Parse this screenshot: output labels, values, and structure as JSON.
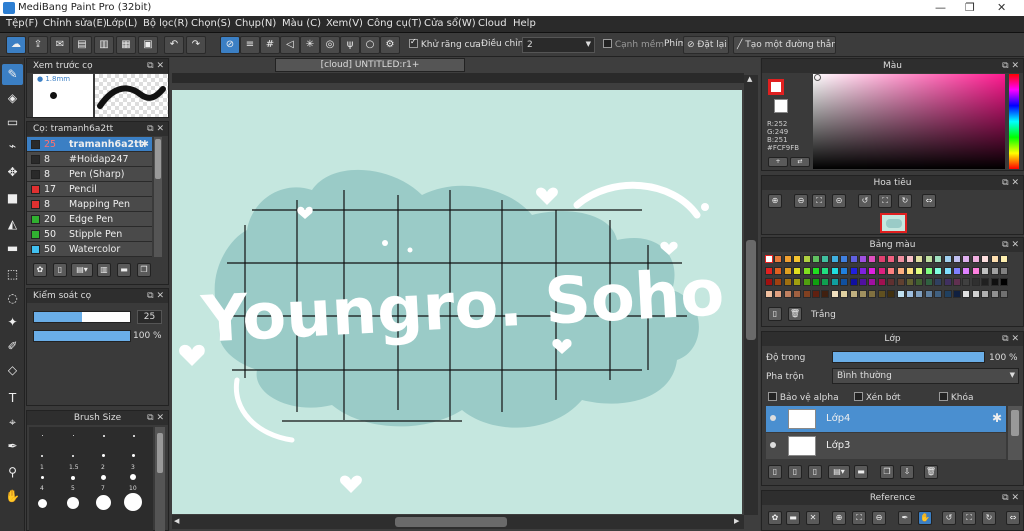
{
  "app": {
    "title": "MediBang Paint Pro (32bit)"
  },
  "menu": [
    "Tệp(F)",
    "Chỉnh sửa(E)",
    "Lớp(L)",
    "Bộ lọc(R)",
    "Chọn(S)",
    "Chụp(N)",
    "Màu (C)",
    "Xem(V)",
    "Công cụ(T)",
    "Cửa sổ(W)",
    "Cloud",
    "Help"
  ],
  "toolbar": {
    "antialias_label": "Khử răng cưa",
    "adjust_label": "Điều chỉnh",
    "adjust_value": "2",
    "sharp_edge_label": "Cạnh mềm",
    "key_label": "Phím",
    "reset_label": "Đặt lại",
    "make_line_label": "Tạo một đường thẳng"
  },
  "brush_preview": {
    "title": "Xem trước cọ",
    "size": "1.8mm"
  },
  "brush_panel": {
    "title": "Cọ: tramanh6a2tt",
    "items": [
      {
        "size": "25",
        "name": "tramanh6a2tt",
        "color": "#2a2a2a"
      },
      {
        "size": "8",
        "name": "#Hoidap247",
        "color": "#2a2a2a"
      },
      {
        "size": "8",
        "name": "Pen (Sharp)",
        "color": "#2a2a2a"
      },
      {
        "size": "17",
        "name": "Pencil",
        "color": "#e03030"
      },
      {
        "size": "8",
        "name": "Mapping Pen",
        "color": "#e03030"
      },
      {
        "size": "20",
        "name": "Edge Pen",
        "color": "#30b030"
      },
      {
        "size": "50",
        "name": "Stipple Pen",
        "color": "#30b030"
      },
      {
        "size": "50",
        "name": "Watercolor",
        "color": "#40c0f0"
      }
    ]
  },
  "brush_control": {
    "title": "Kiểm soát cọ",
    "size_value": "25",
    "opacity_value": "100 %",
    "size_fraction": 0.5,
    "opacity_fraction": 1.0
  },
  "brush_size": {
    "title": "Brush Size",
    "labels": [
      "1",
      "1.5",
      "2",
      "3",
      "4",
      "5",
      "7",
      "10"
    ]
  },
  "canvas": {
    "tab_title": "[cloud] UNTITLED:r1+",
    "artwork_text": "Youngro. Soho"
  },
  "color_panel": {
    "title": "Màu",
    "r": "R:252",
    "g": "G:249",
    "b": "B:251",
    "hex": "#FCF9FB",
    "foreground": "#FCF9FB"
  },
  "navigator": {
    "title": "Hoa tiêu"
  },
  "palette": {
    "title": "Bảng màu",
    "swatch_label": "Trắng"
  },
  "layers": {
    "title": "Lớp",
    "opacity_label": "Độ trong",
    "opacity_value": "100 %",
    "opacity_fraction": 1.0,
    "blend_label": "Pha trộn",
    "blend_value": "Bình thường",
    "protect_alpha": "Bảo vệ alpha",
    "clipping": "Xén bớt",
    "lock": "Khóa",
    "items": [
      {
        "name": "Lớp4",
        "selected": true
      },
      {
        "name": "Lớp3",
        "selected": false
      }
    ]
  },
  "reference": {
    "title": "Reference"
  },
  "colors": {
    "accent": "#3B7FC4",
    "canvas": "#C5E7DF",
    "cloud": "#9ACBC7",
    "panel": "#3A3A3A"
  }
}
